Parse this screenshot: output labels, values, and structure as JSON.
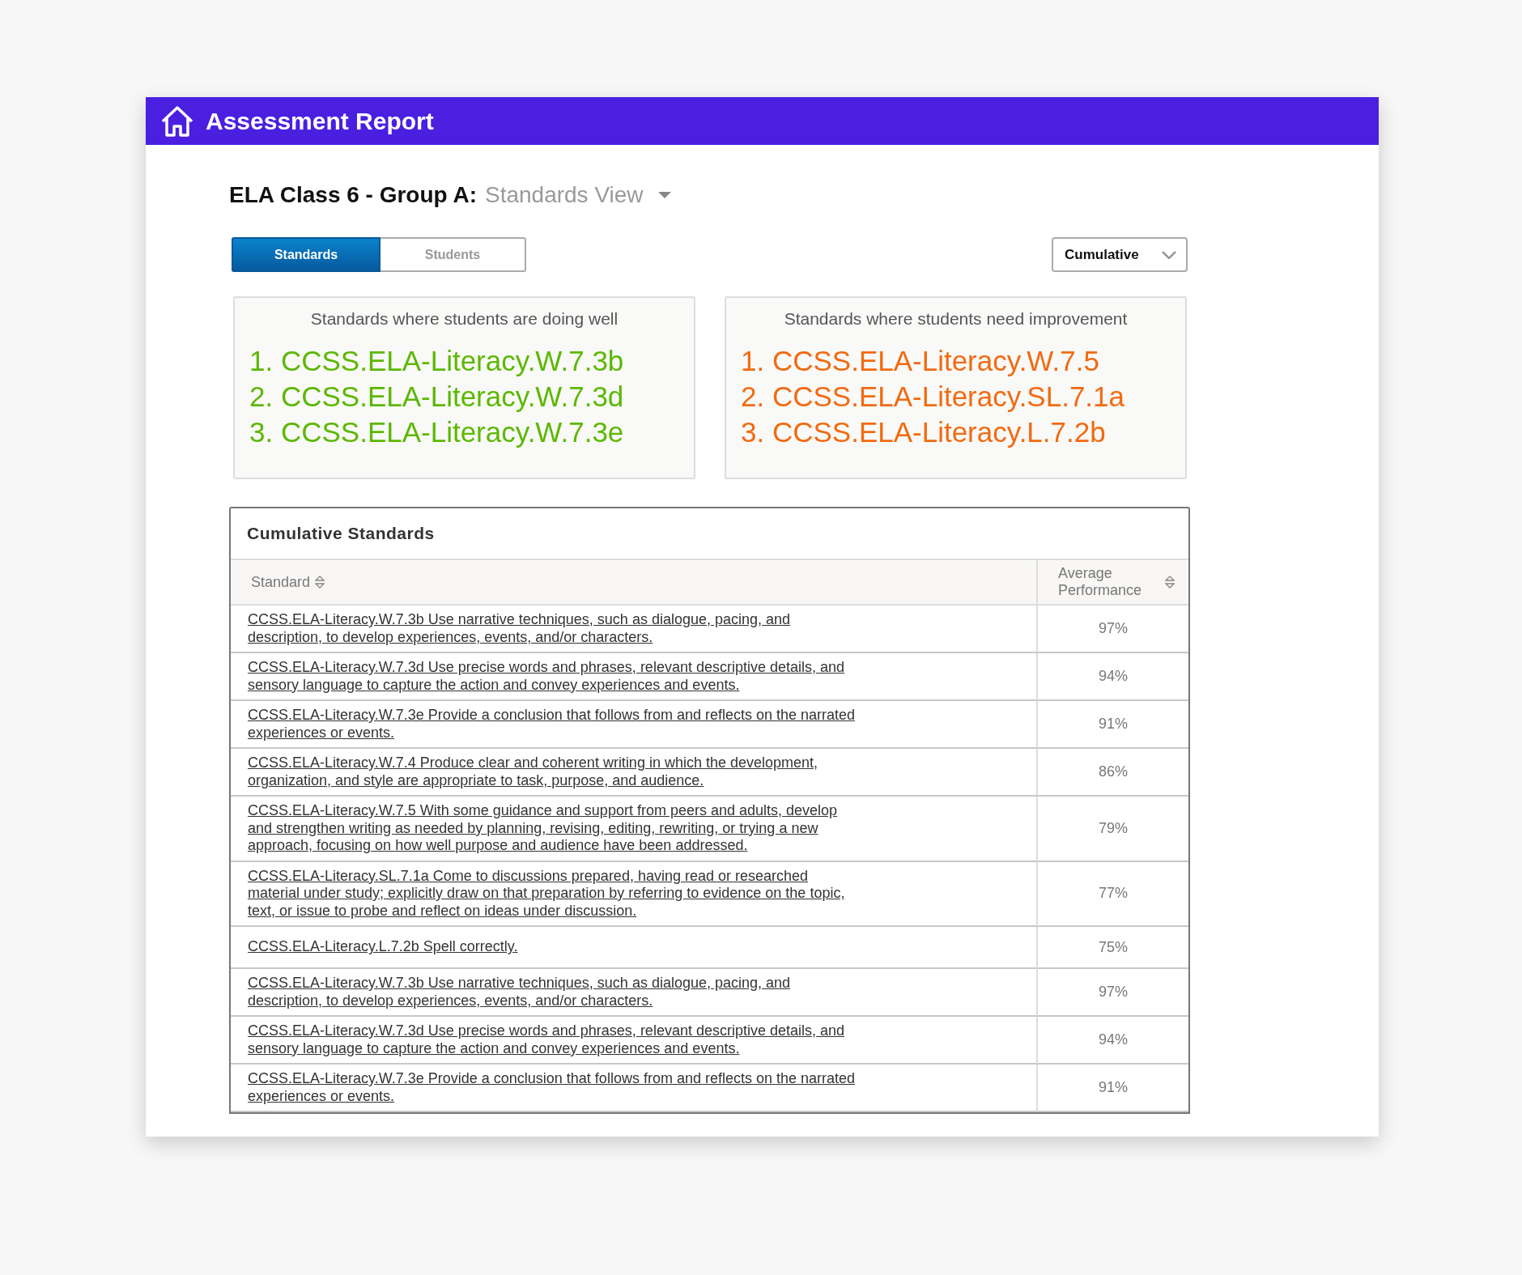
{
  "header": {
    "title": "Assessment Report"
  },
  "heading": {
    "title": "ELA Class 6 - Group A:",
    "view": "Standards View"
  },
  "tabs": [
    {
      "label": "Standards",
      "selected": true
    },
    {
      "label": "Students",
      "selected": false
    }
  ],
  "period_dropdown": {
    "value": "Cumulative"
  },
  "panels": [
    {
      "kind": "well",
      "title": "Standards where students are doing well",
      "items": [
        "1. CCSS.ELA-Literacy.W.7.3b",
        "2. CCSS.ELA-Literacy.W.7.3d",
        "3. CCSS.ELA-Literacy.W.7.3e"
      ]
    },
    {
      "kind": "improve",
      "title": "Standards where students need improvement",
      "items": [
        "1. CCSS.ELA-Literacy.W.7.5",
        "2. CCSS.ELA-Literacy.SL.7.1a",
        "3. CCSS.ELA-Literacy.L.7.2b"
      ]
    }
  ],
  "table": {
    "title": "Cumulative Standards",
    "columns": [
      "Standard",
      "Average Performance"
    ],
    "rows": [
      {
        "standard": "CCSS.ELA-Literacy.W.7.3b Use narrative techniques, such as dialogue, pacing, and description, to develop experiences, events, and/or characters.",
        "average": "97%"
      },
      {
        "standard": "CCSS.ELA-Literacy.W.7.3d Use precise words and phrases, relevant descriptive details, and sensory language to capture the action and convey experiences and events.",
        "average": "94%"
      },
      {
        "standard": "CCSS.ELA-Literacy.W.7.3e Provide a conclusion that follows from and reflects on the narrated experiences or events.",
        "average": "91%"
      },
      {
        "standard": "CCSS.ELA-Literacy.W.7.4 Produce clear and coherent writing in which the development, organization, and style are appropriate to task, purpose, and audience.",
        "average": "86%"
      },
      {
        "standard": "CCSS.ELA-Literacy.W.7.5 With some guidance and support from peers and adults, develop and strengthen writing as needed by planning, revising, editing, rewriting, or trying a new approach, focusing on how well purpose and audience have been addressed.",
        "average": "79%"
      },
      {
        "standard": "CCSS.ELA-Literacy.SL.7.1a Come to discussions prepared, having read or researched material under study; explicitly draw on that preparation by referring to evidence on the topic, text, or issue to probe and reflect on ideas under discussion.",
        "average": "77%"
      },
      {
        "standard": "CCSS.ELA-Literacy.L.7.2b Spell correctly.",
        "average": "75%"
      },
      {
        "standard": "CCSS.ELA-Literacy.W.7.3b Use narrative techniques, such as dialogue, pacing, and description, to develop experiences, events, and/or characters.",
        "average": "97%"
      },
      {
        "standard": "CCSS.ELA-Literacy.W.7.3d Use precise words and phrases, relevant descriptive details, and sensory language to capture the action and convey experiences and events.",
        "average": "94%"
      },
      {
        "standard": "CCSS.ELA-Literacy.W.7.3e Provide a conclusion that follows from and reflects on the narrated experiences or events.",
        "average": "91%"
      }
    ]
  }
}
